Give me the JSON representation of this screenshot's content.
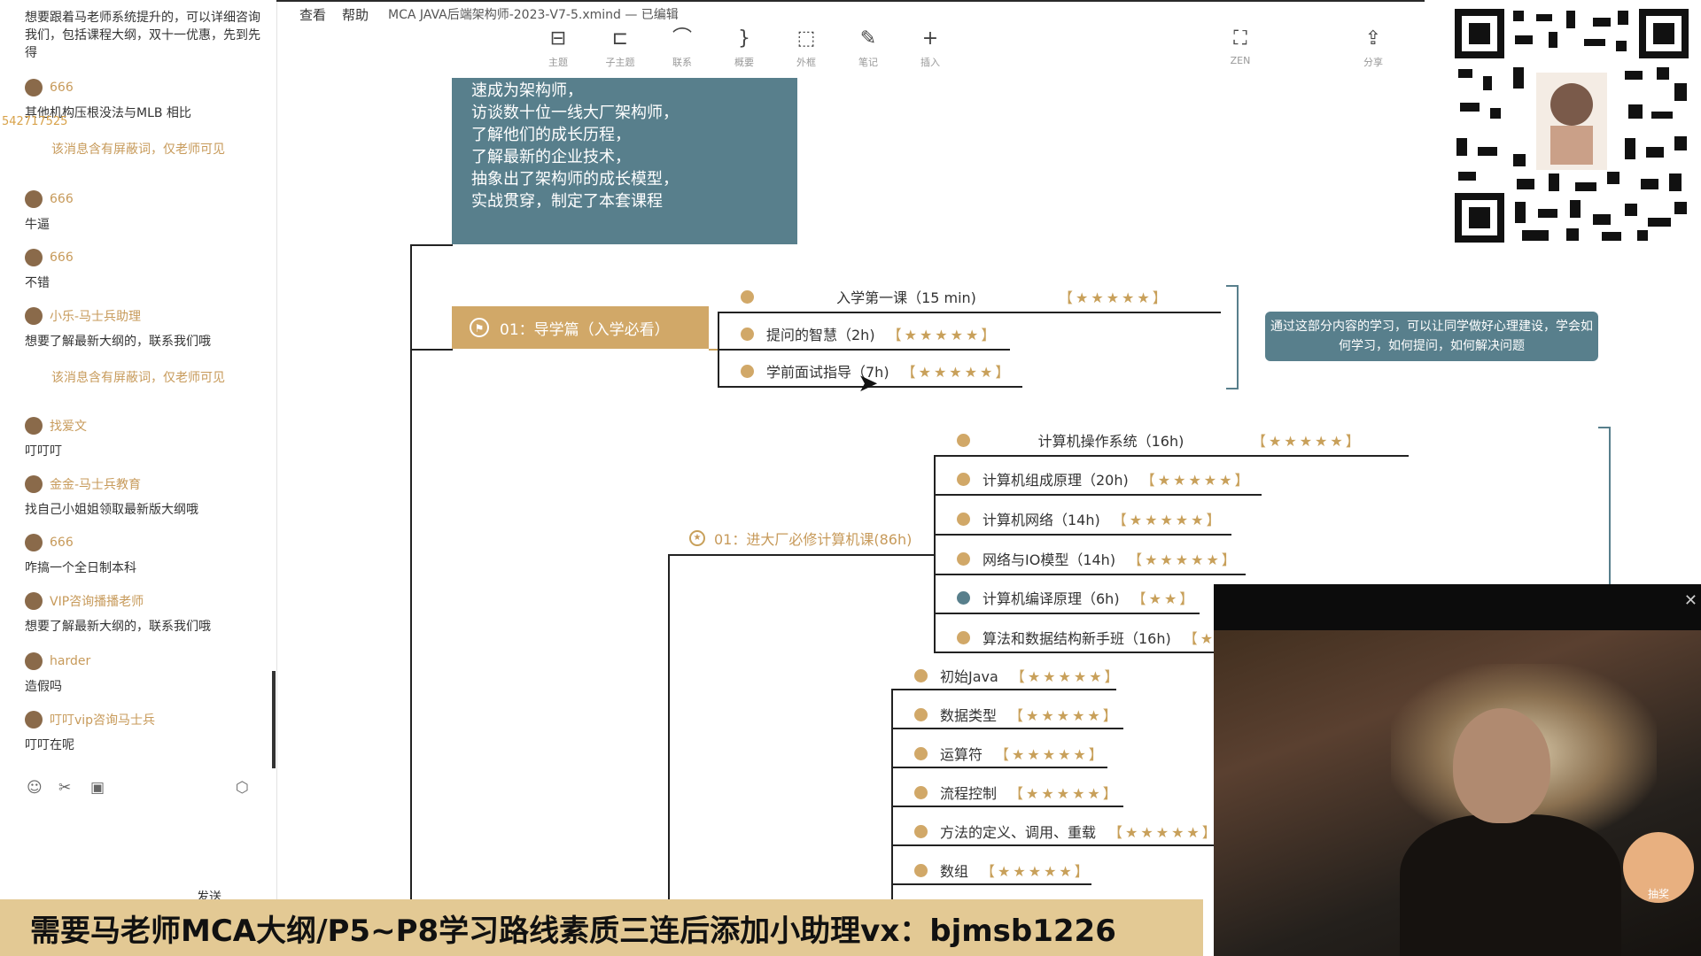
{
  "chat": {
    "header_msg": "想要跟着马老师系统提升的，可以详细咨询我们，包括课程大纲，双十一优惠，先到先得",
    "messages": [
      {
        "user": "666",
        "text": "其他机构压根没法与MLB 相比"
      },
      {
        "user": "",
        "text": "该消息含有屏蔽词，仅老师可见"
      },
      {
        "user": "666",
        "text": "牛逼"
      },
      {
        "user": "666",
        "text": "不错"
      },
      {
        "user": "小乐-马士兵助理",
        "text": "想要了解最新大纲的，联系我们哦"
      },
      {
        "user": "",
        "text": "该消息含有屏蔽词，仅老师可见"
      },
      {
        "user": "找爱文",
        "text": "叮叮叮"
      },
      {
        "user": "金金-马士兵教育",
        "text": "找自己小姐姐领取最新版大纲哦"
      },
      {
        "user": "666",
        "text": "咋搞一个全日制本科"
      },
      {
        "user": "VIP咨询播播老师",
        "text": "想要了解最新大纲的，联系我们哦"
      },
      {
        "user": "harder",
        "text": "造假吗"
      },
      {
        "user": "叮叮vip咨询马士兵",
        "text": "叮叮在呢"
      }
    ],
    "user_id_overlay": "542717525",
    "send_label": "发送"
  },
  "menu": {
    "items": [
      "查看",
      "帮助"
    ],
    "doc_title": "MCA JAVA后端架构师-2023-V7-5.xmind — 已编辑"
  },
  "toolbar": {
    "tools": [
      {
        "icon": "topic-icon",
        "glyph": "⊟",
        "label": "主题"
      },
      {
        "icon": "subtopic-icon",
        "glyph": "⊏",
        "label": "子主题"
      },
      {
        "icon": "relationship-icon",
        "glyph": "⌒",
        "label": "联系"
      },
      {
        "icon": "summary-icon",
        "glyph": "}",
        "label": "概要"
      },
      {
        "icon": "boundary-icon",
        "glyph": "⬚",
        "label": "外框"
      },
      {
        "icon": "note-icon",
        "glyph": "✎",
        "label": "笔记"
      },
      {
        "icon": "insert-icon",
        "glyph": "+",
        "label": "插入"
      }
    ],
    "zen_label": "ZEN",
    "share_label": "分享"
  },
  "mindmap": {
    "intro_text": "速成为架构师，\n访谈数十位一线大厂架构师，\n了解他们的成长历程，\n了解最新的企业技术，\n抽象出了架构师的成长模型，\n实战贯穿，制定了本套课程",
    "guide_topic": "01：导学篇（入学必看）",
    "guide_children": [
      {
        "title": "入学第一课（15 min)",
        "stars": "★★★★★"
      },
      {
        "title": "提问的智慧（2h)",
        "stars": "★★★★★"
      },
      {
        "title": "学前面试指导（7h)",
        "stars": "★★★★★"
      }
    ],
    "tooltip": "通过这部分内容的学习，可以让同学做好心理建设，学会如何学习，如何提问，如何解决问题",
    "cs_topic": "01：进大厂必修计算机课(86h)",
    "cs_children": [
      {
        "title": "计算机操作系统（16h)",
        "stars": "★★★★★"
      },
      {
        "title": "计算机组成原理（20h)",
        "stars": "★★★★★"
      },
      {
        "title": "计算机网络（14h)",
        "stars": "★★★★★"
      },
      {
        "title": "网络与IO模型（14h)",
        "stars": "★★★★★"
      },
      {
        "title": "计算机编译原理（6h)",
        "stars": "★★"
      },
      {
        "title": "算法和数据结构新手班（16h)",
        "stars": "★"
      }
    ],
    "java_children": [
      {
        "title": "初始Java",
        "stars": "★★★★★"
      },
      {
        "title": "数据类型",
        "stars": "★★★★★"
      },
      {
        "title": "运算符",
        "stars": "★★★★★"
      },
      {
        "title": "流程控制",
        "stars": "★★★★★"
      },
      {
        "title": "方法的定义、调用、重载",
        "stars": "★★★★★"
      },
      {
        "title": "数组",
        "stars": "★★★★★"
      }
    ]
  },
  "webcam": {
    "lottery_label": "抽奖"
  },
  "banner": {
    "text": "需要马老师MCA大纲/P5~P8学习路线素质三连后添加小助理vx：bjmsb1226"
  }
}
